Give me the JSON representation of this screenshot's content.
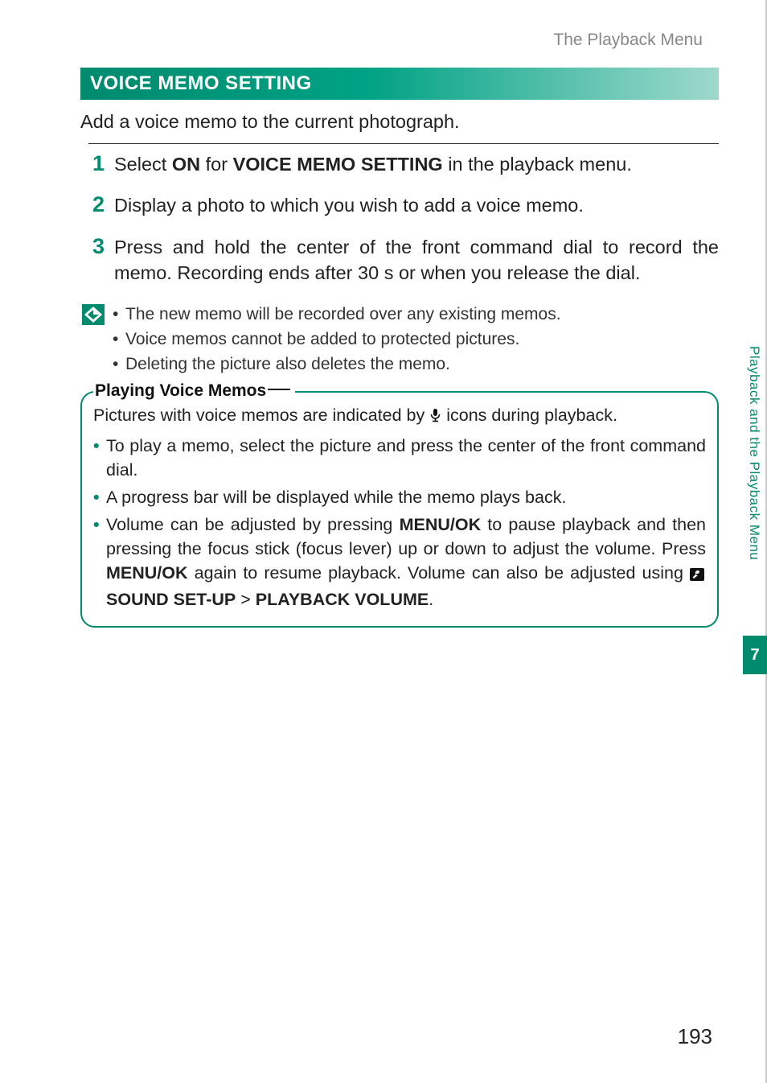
{
  "header": {
    "running_head": "The Playback Menu"
  },
  "section": {
    "title": "VOICE MEMO SETTING",
    "intro": "Add a voice memo to the current photograph."
  },
  "steps": [
    {
      "num": "1",
      "pre": "Select ",
      "bold1": "ON",
      "mid": " for ",
      "bold2": "VOICE MEMO SETTING",
      "post": " in the playback menu."
    },
    {
      "num": "2",
      "text": "Display a photo to which you wish to add a voice memo."
    },
    {
      "num": "3",
      "text": "Press and hold the center of the front command dial to record the memo. Recording ends after 30 s or when you release the dial."
    }
  ],
  "notes": [
    "The new memo will be recorded over any existing memos.",
    "Voice memos cannot be added to protected pictures.",
    "Deleting the picture also deletes the memo."
  ],
  "tip": {
    "title": "Playing Voice Memos",
    "lead_pre": "Pictures with voice memos are indicated by ",
    "lead_post": " icons during playback.",
    "items_plain": [
      "To play a memo, select the picture and press the center of the front command dial.",
      "A progress bar will be displayed while the memo plays back."
    ],
    "item3": {
      "a": "Volume can be adjusted by pressing ",
      "menuok1": "MENU/OK",
      "b": " to pause playback and then pressing the focus stick (focus lever) up or down to adjust the volume. Press ",
      "menuok2": "MENU/OK",
      "c": " again to resume playback. Volume can also be adjusted using ",
      "setup": "SOUND SET-UP",
      "gt": " > ",
      "vol": "PLAYBACK VOLUME",
      "d": "."
    }
  },
  "side": {
    "label": "Playback and the Playback Menu",
    "chapter": "7"
  },
  "page_number": "193",
  "icons": {
    "note": "note-diamond-icon",
    "mic": "microphone-icon",
    "wrench": "wrench-icon"
  }
}
